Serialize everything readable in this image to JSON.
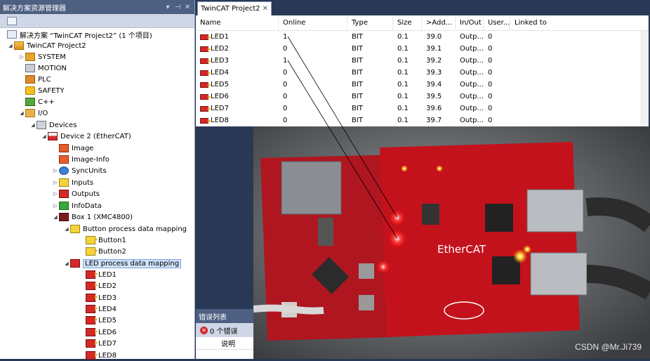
{
  "left_panel": {
    "title": "解决方案资源管理器",
    "controls": [
      "▾",
      "⊣",
      "✕"
    ],
    "tree": [
      {
        "label": "解决方案 “TwinCAT Project2” (1 个项目)",
        "icon": "solution-icon"
      },
      {
        "label": "TwinCAT Project2",
        "icon": "project-icon"
      },
      {
        "label": "SYSTEM",
        "icon": "system-icon"
      },
      {
        "label": "MOTION",
        "icon": "motion-icon"
      },
      {
        "label": "PLC",
        "icon": "plc-icon"
      },
      {
        "label": "SAFETY",
        "icon": "safety-icon"
      },
      {
        "label": "C++",
        "icon": "cpp-icon"
      },
      {
        "label": "I/O",
        "icon": "io-icon"
      },
      {
        "label": "Devices",
        "icon": "devices-icon"
      },
      {
        "label": "Device 2 (EtherCAT)",
        "icon": "ethercat-device-icon"
      },
      {
        "label": "Image",
        "icon": "image-icon"
      },
      {
        "label": "Image-Info",
        "icon": "image-info-icon"
      },
      {
        "label": "SyncUnits",
        "icon": "syncunits-icon"
      },
      {
        "label": "Inputs",
        "icon": "inputs-icon"
      },
      {
        "label": "Outputs",
        "icon": "outputs-icon"
      },
      {
        "label": "InfoData",
        "icon": "infodata-icon"
      },
      {
        "label": "Box 1 (XMC4800)",
        "icon": "box-icon"
      },
      {
        "label": "Button process data mapping",
        "icon": "button-mapping-icon"
      },
      {
        "label": "Button1",
        "icon": "button-variable-icon"
      },
      {
        "label": "Button2",
        "icon": "button-variable-icon"
      },
      {
        "label": "LED process data mapping",
        "icon": "led-mapping-icon"
      },
      {
        "label": "LED1",
        "icon": "led-variable-icon"
      },
      {
        "label": "LED2",
        "icon": "led-variable-icon"
      },
      {
        "label": "LED3",
        "icon": "led-variable-icon"
      },
      {
        "label": "LED4",
        "icon": "led-variable-icon"
      },
      {
        "label": "LED5",
        "icon": "led-variable-icon"
      },
      {
        "label": "LED6",
        "icon": "led-variable-icon"
      },
      {
        "label": "LED7",
        "icon": "led-variable-icon"
      },
      {
        "label": "LED8",
        "icon": "led-variable-icon"
      }
    ]
  },
  "doc_tab": {
    "label": "TwinCAT Project2",
    "close": "✕"
  },
  "grid": {
    "columns": [
      "Name",
      "Online",
      "Type",
      "Size",
      ">Add...",
      "In/Out",
      "User...",
      "Linked to"
    ],
    "rows": [
      {
        "name": "LED1",
        "online": "1",
        "type": "BIT",
        "size": "0.1",
        "addr": "39.0",
        "io": "Outp...",
        "user": "0",
        "link": ""
      },
      {
        "name": "LED2",
        "online": "0",
        "type": "BIT",
        "size": "0.1",
        "addr": "39.1",
        "io": "Outp...",
        "user": "0",
        "link": ""
      },
      {
        "name": "LED3",
        "online": "1",
        "type": "BIT",
        "size": "0.1",
        "addr": "39.2",
        "io": "Outp...",
        "user": "0",
        "link": ""
      },
      {
        "name": "LED4",
        "online": "0",
        "type": "BIT",
        "size": "0.1",
        "addr": "39.3",
        "io": "Outp...",
        "user": "0",
        "link": ""
      },
      {
        "name": "LED5",
        "online": "0",
        "type": "BIT",
        "size": "0.1",
        "addr": "39.4",
        "io": "Outp...",
        "user": "0",
        "link": ""
      },
      {
        "name": "LED6",
        "online": "0",
        "type": "BIT",
        "size": "0.1",
        "addr": "39.5",
        "io": "Outp...",
        "user": "0",
        "link": ""
      },
      {
        "name": "LED7",
        "online": "0",
        "type": "BIT",
        "size": "0.1",
        "addr": "39.6",
        "io": "Outp...",
        "user": "0",
        "link": ""
      },
      {
        "name": "LED8",
        "online": "0",
        "type": "BIT",
        "size": "0.1",
        "addr": "39.7",
        "io": "Outp...",
        "user": "0",
        "link": ""
      }
    ]
  },
  "error_list": {
    "title": "错误列表",
    "error_count": "0 个错误",
    "column": "说明"
  },
  "photo": {
    "watermark": "CSDN @Mr.Ji739",
    "board_text": "EtherCAT"
  }
}
